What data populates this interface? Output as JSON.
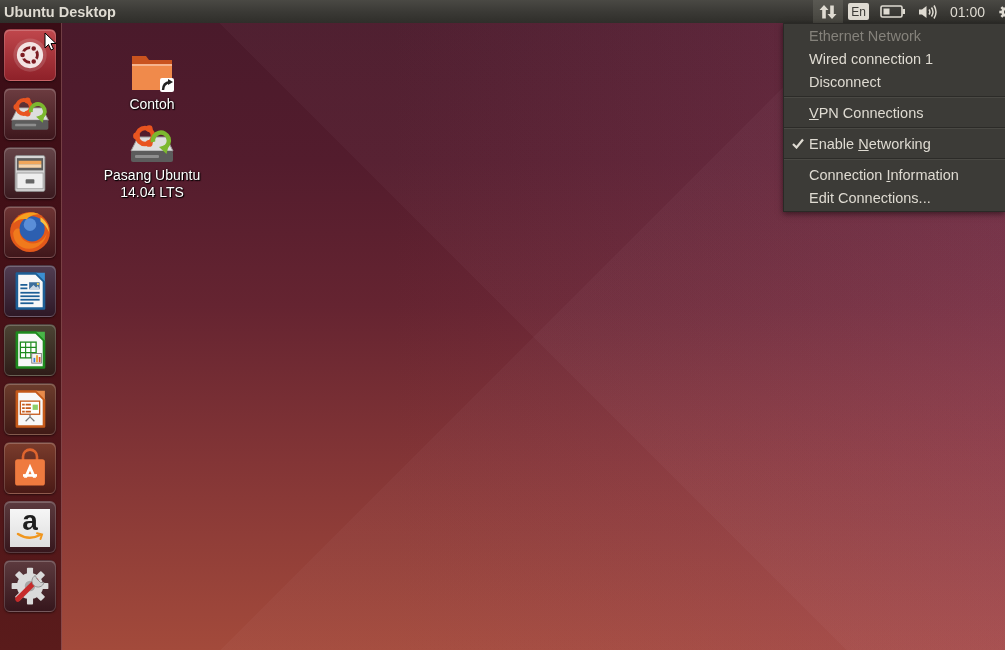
{
  "panel": {
    "title": "Ubuntu Desktop",
    "indicators": [
      {
        "kind": "network",
        "selected": true
      },
      {
        "kind": "keyboard",
        "label": "En",
        "selected": false
      },
      {
        "kind": "battery",
        "selected": false
      },
      {
        "kind": "volume",
        "selected": false
      },
      {
        "kind": "clock",
        "label": "01:00",
        "selected": false
      },
      {
        "kind": "settings",
        "selected": false
      }
    ]
  },
  "launcher": {
    "items": [
      {
        "kind": "dash"
      },
      {
        "kind": "installer"
      },
      {
        "kind": "files"
      },
      {
        "kind": "browser"
      },
      {
        "kind": "writer"
      },
      {
        "kind": "calc"
      },
      {
        "kind": "impress"
      },
      {
        "kind": "store"
      },
      {
        "kind": "web-app",
        "glyph": "a"
      },
      {
        "kind": "system-settings"
      }
    ]
  },
  "desktop": {
    "icons": [
      {
        "kind": "folder",
        "label": "Contoh"
      },
      {
        "kind": "installer",
        "label": "Pasang Ubuntu 14.04 LTS"
      }
    ]
  },
  "network_menu": {
    "sections": [
      {
        "items": [
          {
            "label": "Ethernet Network",
            "disabled": true,
            "checked": false
          },
          {
            "label": "Wired connection 1",
            "disabled": false,
            "checked": false
          },
          {
            "label": "Disconnect",
            "disabled": false,
            "checked": false
          }
        ]
      },
      {
        "items": [
          {
            "label_parts": [
              {
                "text": "V",
                "underlined": true
              },
              {
                "text": "PN Connections",
                "underlined": false
              }
            ],
            "disabled": false,
            "checked": false
          }
        ]
      },
      {
        "items": [
          {
            "label_parts": [
              {
                "text": "Enable ",
                "underlined": false
              },
              {
                "text": "N",
                "underlined": true
              },
              {
                "text": "etworking",
                "underlined": false
              }
            ],
            "disabled": false,
            "checked": true
          }
        ]
      },
      {
        "items": [
          {
            "label_parts": [
              {
                "text": "Connection ",
                "underlined": false
              },
              {
                "text": "I",
                "underlined": true
              },
              {
                "text": "nformation",
                "underlined": false
              }
            ],
            "disabled": false,
            "checked": false
          },
          {
            "label": "Edit Connections...",
            "disabled": false,
            "checked": false
          }
        ]
      }
    ]
  }
}
